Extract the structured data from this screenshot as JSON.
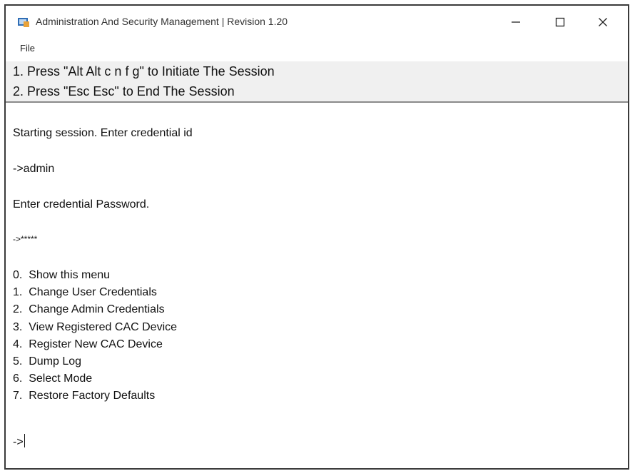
{
  "window": {
    "title": "Administration And Security Management  |  Revision 1.20",
    "minimize_icon": "minimize-icon",
    "maximize_icon": "maximize-icon",
    "close_icon": "close-icon"
  },
  "menubar": {
    "file_label": "File"
  },
  "instructions": {
    "line1": "1. Press \"Alt Alt c n f g\" to Initiate The Session",
    "line2": "2. Press \"Esc Esc\" to End The Session"
  },
  "console": {
    "prompt_id": "Starting session. Enter credential id",
    "input_id": "->admin",
    "prompt_password": "Enter credential Password.",
    "input_password": "->*****",
    "menu": [
      "0.  Show this menu",
      "1.  Change User Credentials",
      "2.  Change Admin Credentials",
      "3.  View Registered CAC Device",
      "4.  Register New CAC Device",
      "5.  Dump Log",
      "6.  Select Mode",
      "7.  Restore Factory Defaults"
    ],
    "current_prompt": "->"
  },
  "colors": {
    "instruction_band": "#f0f0f0",
    "app_icon_primary": "#2f6db5",
    "app_icon_accent": "#e8a23a"
  }
}
